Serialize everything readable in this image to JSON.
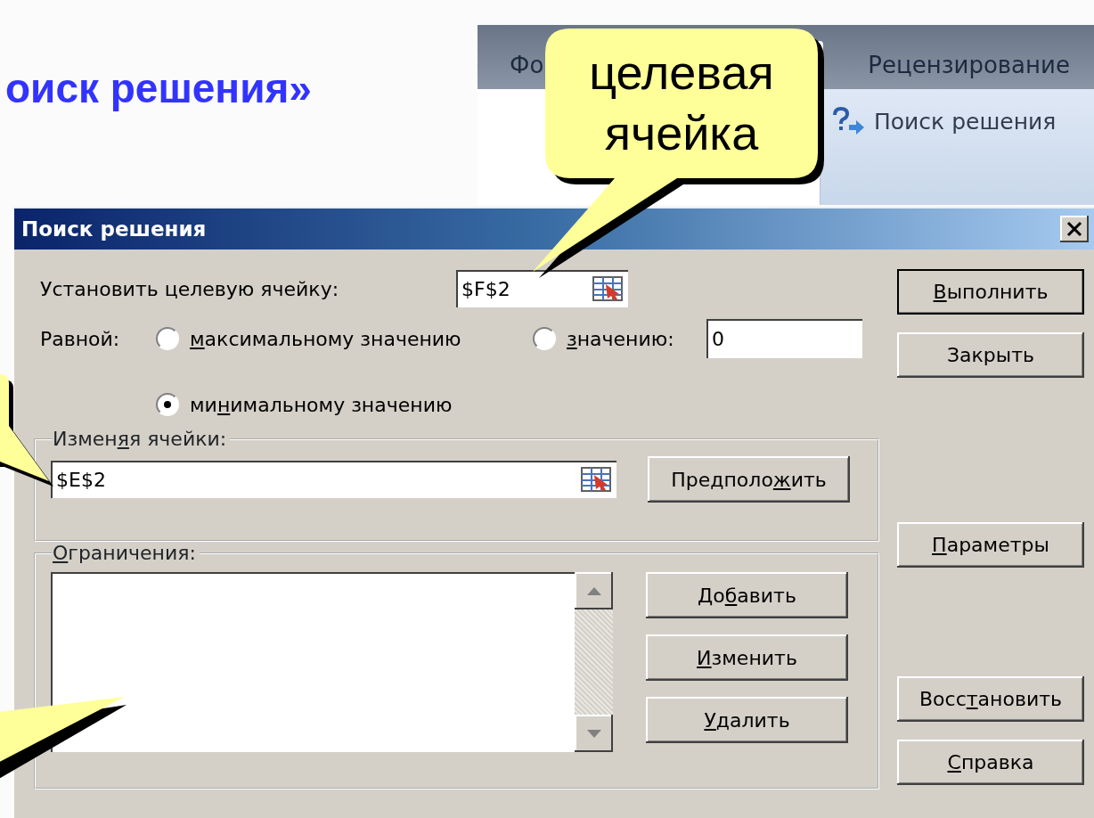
{
  "slide_title": "оиск решения»",
  "ribbon": {
    "tabs": [
      {
        "label": "Фо",
        "selected": false
      },
      {
        "label": "Рецензирование",
        "selected": false
      }
    ],
    "command": "Поиск решения"
  },
  "callout": {
    "lines": [
      "целевая",
      "ячейка"
    ]
  },
  "dialog": {
    "title": "Поиск решения",
    "target": {
      "label": "Установить целевую ячейку:",
      "value": "$F$2"
    },
    "equal_label": "Равной:",
    "options": [
      {
        "label": {
          "key": "м",
          "post": "аксимальному значению"
        },
        "selected": false
      },
      {
        "label": {
          "key": "з",
          "post": "начению:"
        },
        "selected": false,
        "value": "0"
      },
      {
        "label": {
          "pre": "ми",
          "key": "н",
          "post": "имальному значению"
        },
        "selected": true
      }
    ],
    "changing": {
      "legend": {
        "pre": "Измен",
        "key": "я",
        "post": "я ячейки:"
      },
      "value": "$E$2",
      "button": {
        "pre": "Предполо",
        "key": "ж",
        "post": "ить"
      }
    },
    "constraints": {
      "legend": {
        "key": "О",
        "post": "граничения:"
      },
      "buttons": [
        {
          "pre": "До",
          "key": "б",
          "post": "авить"
        },
        {
          "key": "И",
          "post": "зменить"
        },
        {
          "key": "У",
          "post": "далить"
        }
      ]
    },
    "side_buttons": [
      {
        "label": {
          "key": "В",
          "post": "ыполнить"
        },
        "default": true
      },
      {
        "label": {
          "pre": "Закрыть"
        },
        "default": false
      },
      {
        "label": {
          "key": "П",
          "post": "араметры"
        },
        "default": false
      },
      {
        "label": {
          "pre": "Восс",
          "key": "т",
          "post": "ановить"
        },
        "default": false
      },
      {
        "label": {
          "key": "С",
          "post": "правка"
        },
        "default": false
      }
    ]
  }
}
